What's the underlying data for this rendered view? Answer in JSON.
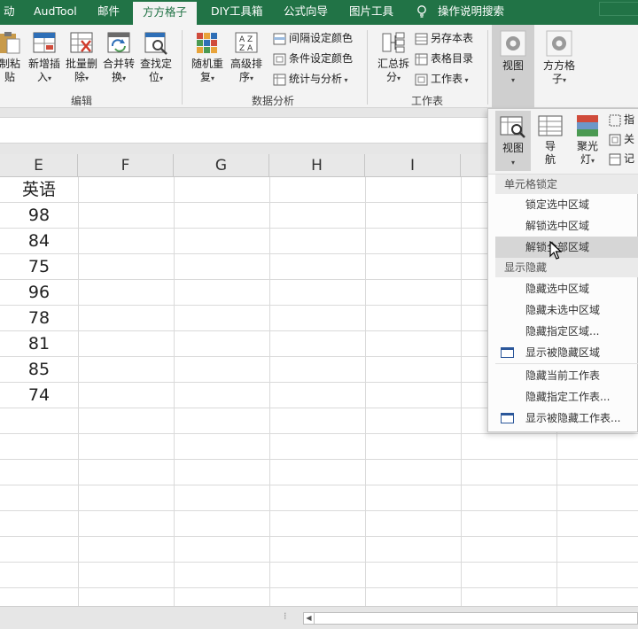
{
  "menubar": {
    "tabs": [
      "动",
      "AudTool",
      "邮件",
      "方方格子",
      "DIY工具箱",
      "公式向导",
      "图片工具"
    ],
    "active_tab": "方方格子",
    "tell_me": "操作说明搜索"
  },
  "ribbon": {
    "buttons": {
      "copy_paste": [
        "制粘",
        "贴"
      ],
      "insert": [
        "新增插",
        "入"
      ],
      "batch_delete": [
        "批量删",
        "除"
      ],
      "merge": [
        "合并转",
        "换"
      ],
      "locate": [
        "查找定",
        "位"
      ],
      "random": [
        "随机重",
        "复"
      ],
      "sort": [
        "高级排",
        "序"
      ],
      "summary": [
        "汇总拆",
        "分"
      ],
      "view": [
        "视图"
      ],
      "ffgz": [
        "方方格",
        "子"
      ]
    },
    "small_buttons": {
      "interval_color": "间隔设定颜色",
      "condition_color": "条件设定颜色",
      "stats": "统计与分析",
      "save_copy": "另存本表",
      "catalog": "表格目录",
      "worksheet": "工作表"
    },
    "groups": {
      "edit": "编辑",
      "data_analysis": "数据分析",
      "worksheet": "工作表"
    }
  },
  "grid": {
    "columns": [
      "E",
      "F",
      "G",
      "H",
      "I"
    ],
    "column_e": [
      "英语",
      "98",
      "84",
      "75",
      "96",
      "78",
      "81",
      "85",
      "74"
    ]
  },
  "dropdown": {
    "top_buttons": {
      "view": [
        "视图"
      ],
      "nav": [
        "导",
        "航"
      ],
      "spotlight": [
        "聚光",
        "灯"
      ],
      "small": [
        "指",
        "关",
        "记"
      ]
    },
    "section_lock": "单元格锁定",
    "lock_items": [
      "锁定选中区域",
      "解锁选中区域",
      "解锁全部区域"
    ],
    "section_hide": "显示隐藏",
    "hide_items": [
      "隐藏选中区域",
      "隐藏未选中区域",
      "隐藏指定区域...",
      "显示被隐藏区域",
      "隐藏当前工作表",
      "隐藏指定工作表...",
      "显示被隐藏工作表..."
    ],
    "highlighted_item": "解锁全部区域"
  },
  "colors": {
    "excel_green": "#217346",
    "ribbon_bg": "#f3f3f3",
    "highlight": "#d6d6d6"
  }
}
